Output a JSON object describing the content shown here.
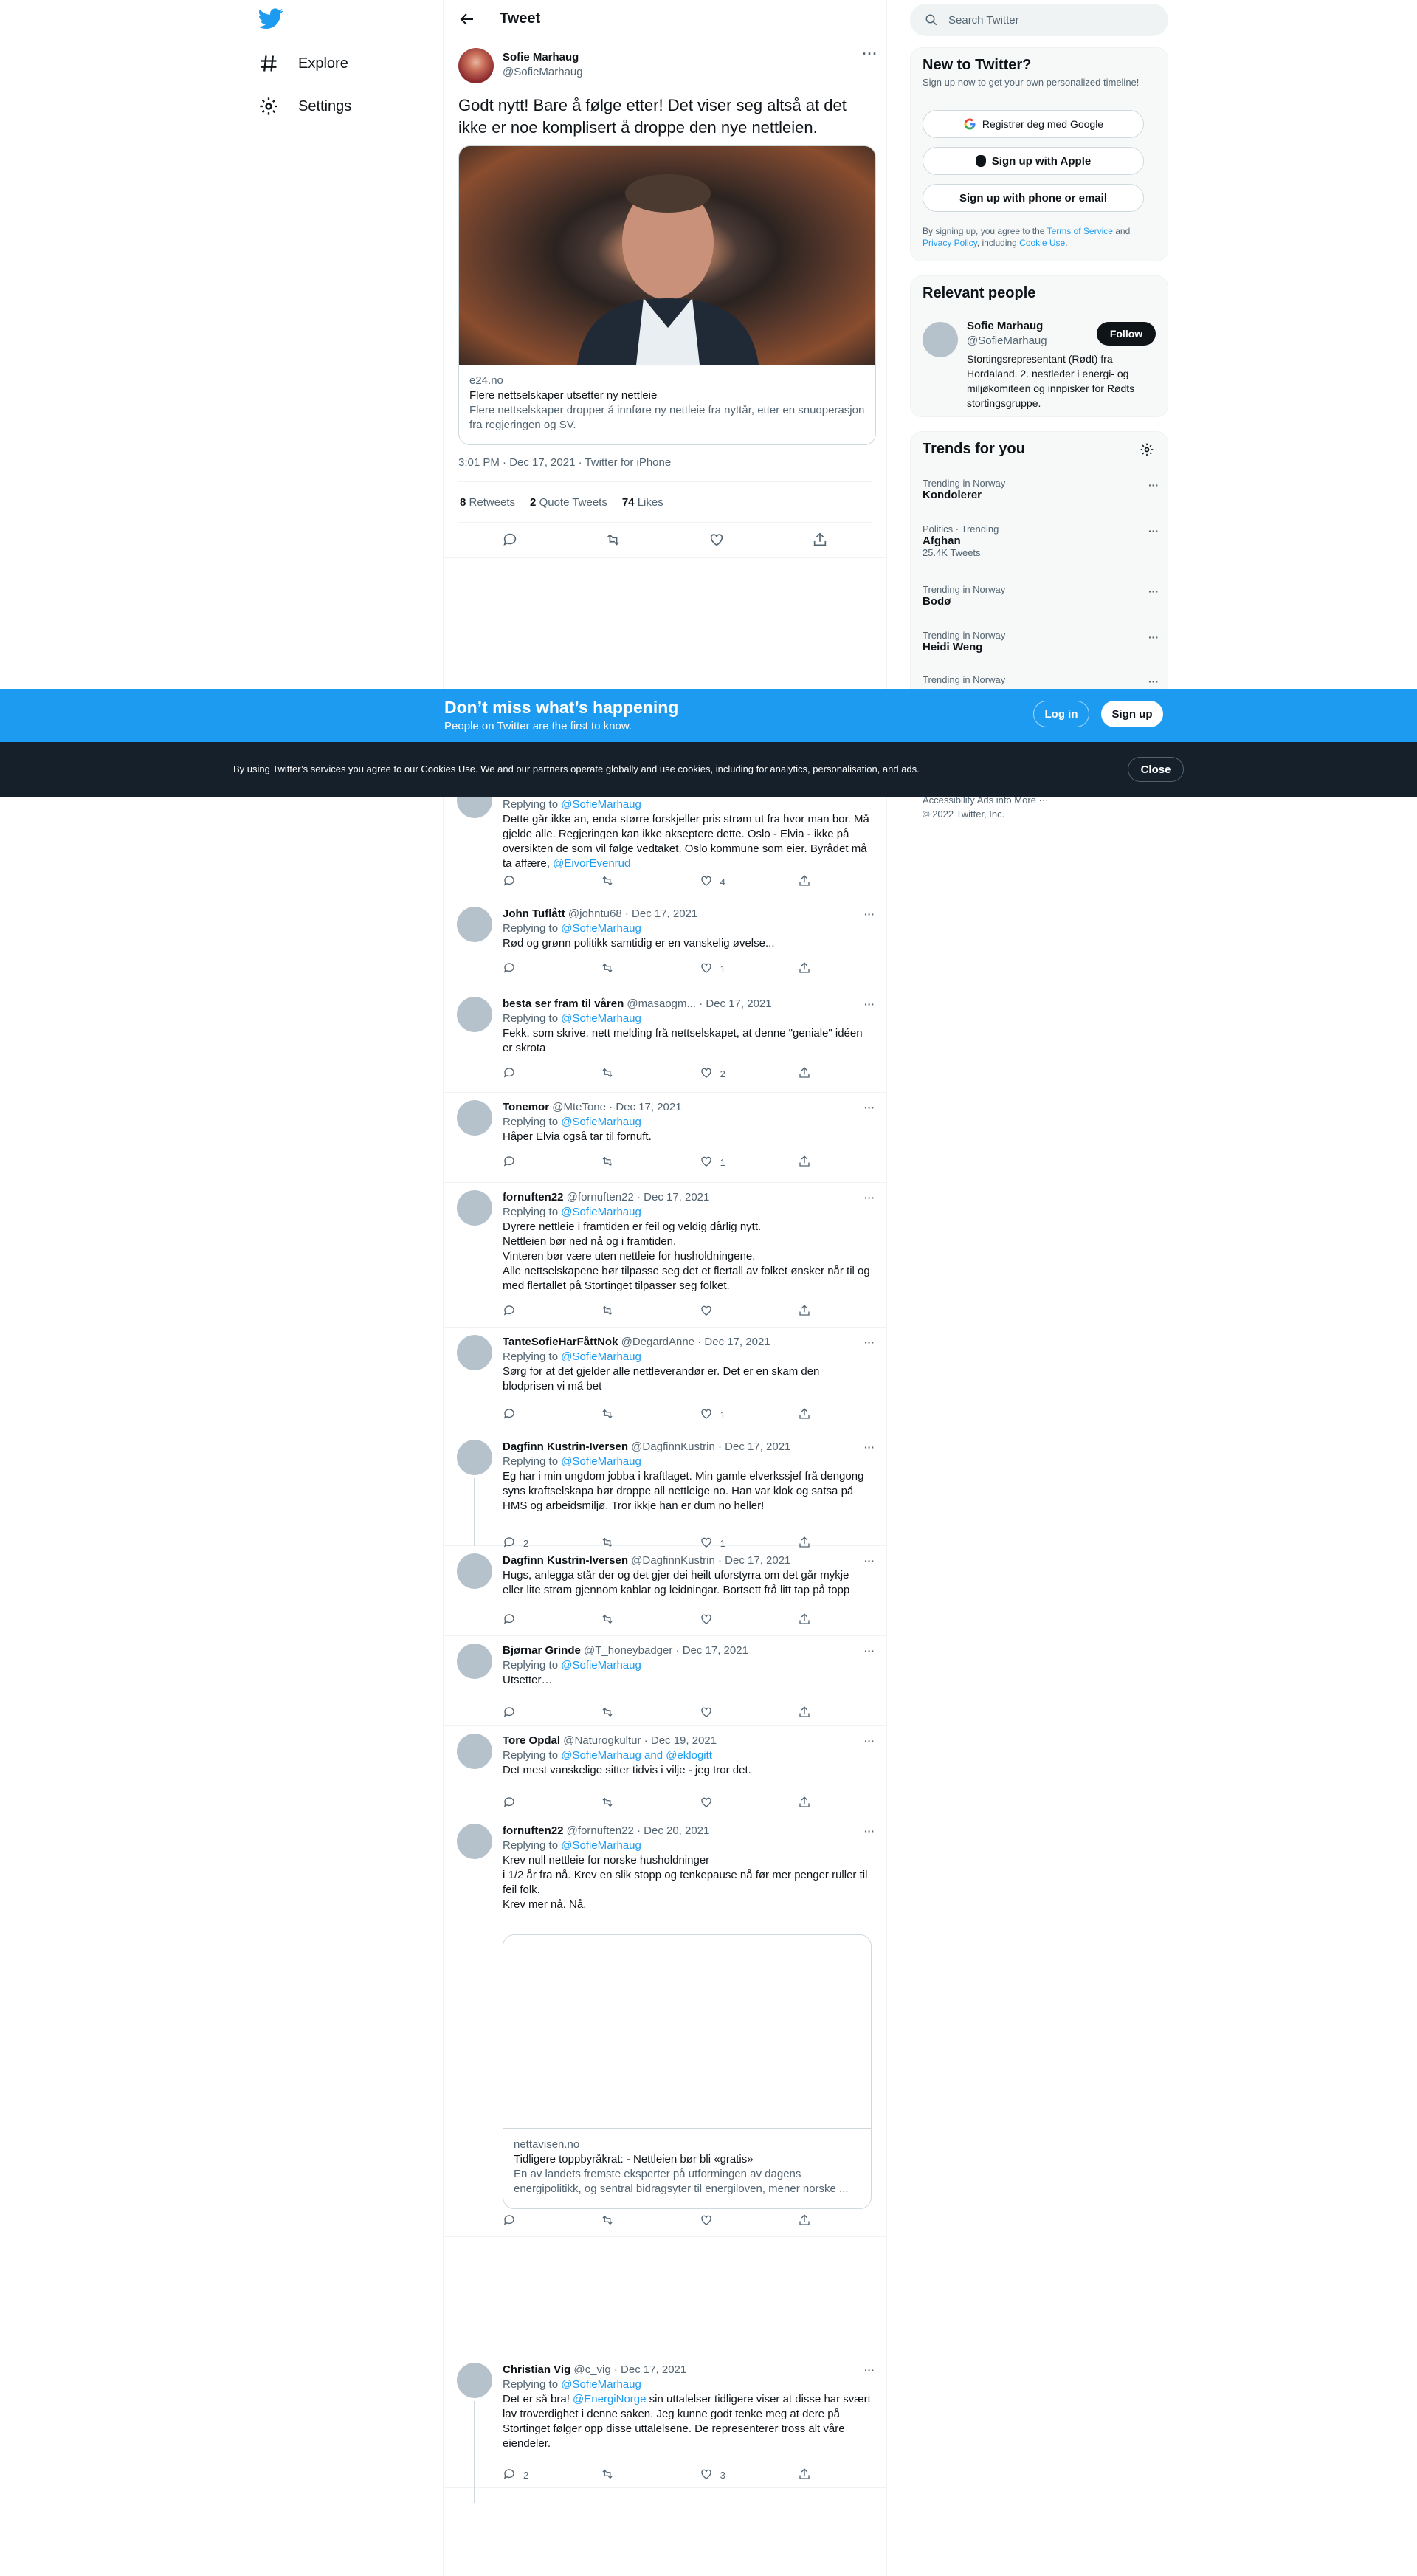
{
  "nav": {
    "explore": "Explore",
    "settings": "Settings"
  },
  "header": {
    "title": "Tweet"
  },
  "tweet": {
    "name": "Sofie Marhaug",
    "handle": "@SofieMarhaug",
    "text": "Godt nytt! Bare å følge etter! Det viser seg altså at det ikke er noe komplisert å droppe den nye nettleien.",
    "card": {
      "domain": "e24.no",
      "title": "Flere nettselskaper utsetter ny nettleie",
      "desc": "Flere nettselskaper dropper å innføre ny nettleie fra nyttår, etter en snuoperasjon fra regjeringen og SV."
    },
    "timestamp": "3:01 PM · Dec 17, 2021 · Twitter for iPhone",
    "retweets": "8",
    "retweets_label": "Retweets",
    "quotes": "2",
    "quotes_label": "Quote Tweets",
    "likes": "74",
    "likes_label": "Likes"
  },
  "sidebar": {
    "search_placeholder": "Search Twitter",
    "new": {
      "title": "New to Twitter?",
      "sub": "Sign up now to get your own personalized timeline!",
      "google": "Registrer deg med Google",
      "apple": "Sign up with Apple",
      "phone": "Sign up with phone or email",
      "legal1": "By signing up, you agree to the ",
      "tos": "Terms of Service",
      "and": " and",
      "privacy": "Privacy Policy",
      "including": ", including ",
      "cookie": "Cookie Use",
      "dot": "."
    },
    "relevant": {
      "title": "Relevant people",
      "name": "Sofie Marhaug",
      "handle": "@SofieMarhaug",
      "follow": "Follow",
      "bio": "Stortingsrepresentant (Rødt) fra Hordaland. 2. nestleder i energi- og miljøkomiteen og innpisker for Rødts stortingsgruppe."
    },
    "trends": {
      "title": "Trends for you",
      "items": [
        {
          "context": "Trending in Norway",
          "topic": "Kondolerer",
          "count": ""
        },
        {
          "context": "Politics · Trending",
          "topic": "Afghan",
          "count": "25.4K Tweets"
        },
        {
          "context": "Trending in Norway",
          "topic": "Bodø",
          "count": ""
        },
        {
          "context": "Trending in Norway",
          "topic": "Heidi Weng",
          "count": ""
        },
        {
          "context": "Trending in Norway",
          "topic": "",
          "count": ""
        }
      ]
    },
    "footer": {
      "line1": "Accessibility   Ads info   More ···",
      "line2": "© 2022 Twitter, Inc."
    }
  },
  "banner": {
    "title": "Don’t miss what’s happening",
    "sub": "People on Twitter are the first to know.",
    "login": "Log in",
    "signup": "Sign up"
  },
  "cookie": {
    "text": "By using Twitter’s services you agree to our Cookies Use. We and our partners operate globally and use cookies, including for analytics, personalisation, and ads.",
    "close": "Close"
  },
  "replies": [
    {
      "name": "",
      "handle": "",
      "date": "",
      "replying": "@SofieMarhaug",
      "text": "Dette går ikke an, enda større forskjeller pris strøm ut fra hvor man bor. Må gjelde alle. Regjeringen kan ikke akseptere dette. Oslo - Elvia - ikke på oversikten de som vil følge vedtaket. Oslo kommune som eier. Byrådet må ta affære, ",
      "mention": "@EivorEvenrud",
      "likes": "4",
      "rts": "",
      "reps": ""
    },
    {
      "name": "John Tuflått",
      "handle": "@johntu68",
      "date": "Dec 17, 2021",
      "replying": "@SofieMarhaug",
      "text": "Rød og grønn politikk samtidig er en vanskelig øvelse...",
      "likes": "1",
      "rts": "",
      "reps": ""
    },
    {
      "name": "besta ser fram til våren",
      "handle": "@masaogm...",
      "date": "Dec 17, 2021",
      "replying": "@SofieMarhaug",
      "text": "Fekk, som skrive, nett melding frå nettselskapet, at denne \"geniale\" idéen er skrota",
      "likes": "2",
      "rts": "",
      "reps": ""
    },
    {
      "name": "Tonemor",
      "handle": "@MteTone",
      "date": "Dec 17, 2021",
      "replying": "@SofieMarhaug",
      "text": "Håper Elvia også tar til fornuft.",
      "likes": "1",
      "rts": "",
      "reps": ""
    },
    {
      "name": "fornuften22",
      "handle": "@fornuften22",
      "date": "Dec 17, 2021",
      "replying": "@SofieMarhaug",
      "text": "Dyrere nettleie i framtiden er feil og veldig dårlig nytt.\nNettleien bør ned nå og i framtiden.\nVinteren bør være uten nettleie for husholdningene.\nAlle nettselskapene bør tilpasse seg det et flertall av folket ønsker når til og med flertallet på Stortinget tilpasser seg folket.",
      "likes": "",
      "rts": "",
      "reps": ""
    },
    {
      "name": "TanteSofieHarFåttNok",
      "handle": "@DegardAnne",
      "date": "Dec 17, 2021",
      "replying": "@SofieMarhaug",
      "text": "Sørg for at det gjelder alle nettleverandør er. Det er en skam den blodprisen vi må bet",
      "likes": "1",
      "rts": "",
      "reps": ""
    },
    {
      "name": "Dagfinn Kustrin-Iversen",
      "handle": "@DagfinnKustrin",
      "date": "Dec 17, 2021",
      "replying": "@SofieMarhaug",
      "text": "Eg har i min ungdom jobba i kraftlaget. Min gamle elverkssjef frå dengong syns kraftselskapa bør droppe all nettleige no. Han var klok og satsa på HMS og arbeidsmiljø. Tror ikkje han er dum no heller!",
      "likes": "1",
      "rts": "",
      "reps": "2"
    },
    {
      "name": "Dagfinn Kustrin-Iversen",
      "handle": "@DagfinnKustrin",
      "date": "Dec 17, 2021",
      "replying": "",
      "text": "Hugs, anlegga står der og det gjer dei heilt uforstyrra om det går mykje eller lite strøm gjennom kablar og leidningar. Bortsett frå litt tap på topp",
      "likes": "",
      "rts": "",
      "reps": ""
    },
    {
      "name": "Bjørnar Grinde",
      "handle": "@T_honeybadger",
      "date": "Dec 17, 2021",
      "replying": "@SofieMarhaug",
      "text": "Utsetter…",
      "likes": "",
      "rts": "",
      "reps": ""
    },
    {
      "name": "Tore Opdal",
      "handle": "@Naturogkultur",
      "date": "Dec 19, 2021",
      "replying": "@SofieMarhaug and @eklogitt",
      "text": "Det mest vanskelige sitter tidvis i vilje - jeg tror det.",
      "likes": "",
      "rts": "",
      "reps": ""
    },
    {
      "name": "fornuften22",
      "handle": "@fornuften22",
      "date": "Dec 20, 2021",
      "replying": "@SofieMarhaug",
      "text": "Krev null nettleie for norske husholdninger\n i 1/2 år fra nå. Krev en slik stopp og tenkepause nå før mer penger ruller til feil folk.\nKrev mer nå. Nå.",
      "likes": "",
      "rts": "",
      "reps": "",
      "card": {
        "domain": "nettavisen.no",
        "title": "Tidligere toppbyråkrat: - Nettleien bør bli «gratis»",
        "desc": "En av landets fremste eksperter på utformingen av dagens energipolitikk, og sentral bidragsyter til energiloven, mener norske ..."
      }
    },
    {
      "name": "Christian Vig",
      "handle": "@c_vig",
      "date": "Dec 17, 2021",
      "replying": "@SofieMarhaug",
      "text_a": "Det er så bra! ",
      "mention": "@EnergiNorge",
      "text_b": " sin uttalelser tidligere viser at disse har svært lav troverdighet i denne saken. Jeg kunne godt tenke meg at dere på Stortinget følger opp disse uttalelsene. De representerer tross alt våre eiendeler.",
      "likes": "3",
      "rts": "",
      "reps": "2"
    }
  ],
  "labels": {
    "replying_to": "Replying to "
  }
}
